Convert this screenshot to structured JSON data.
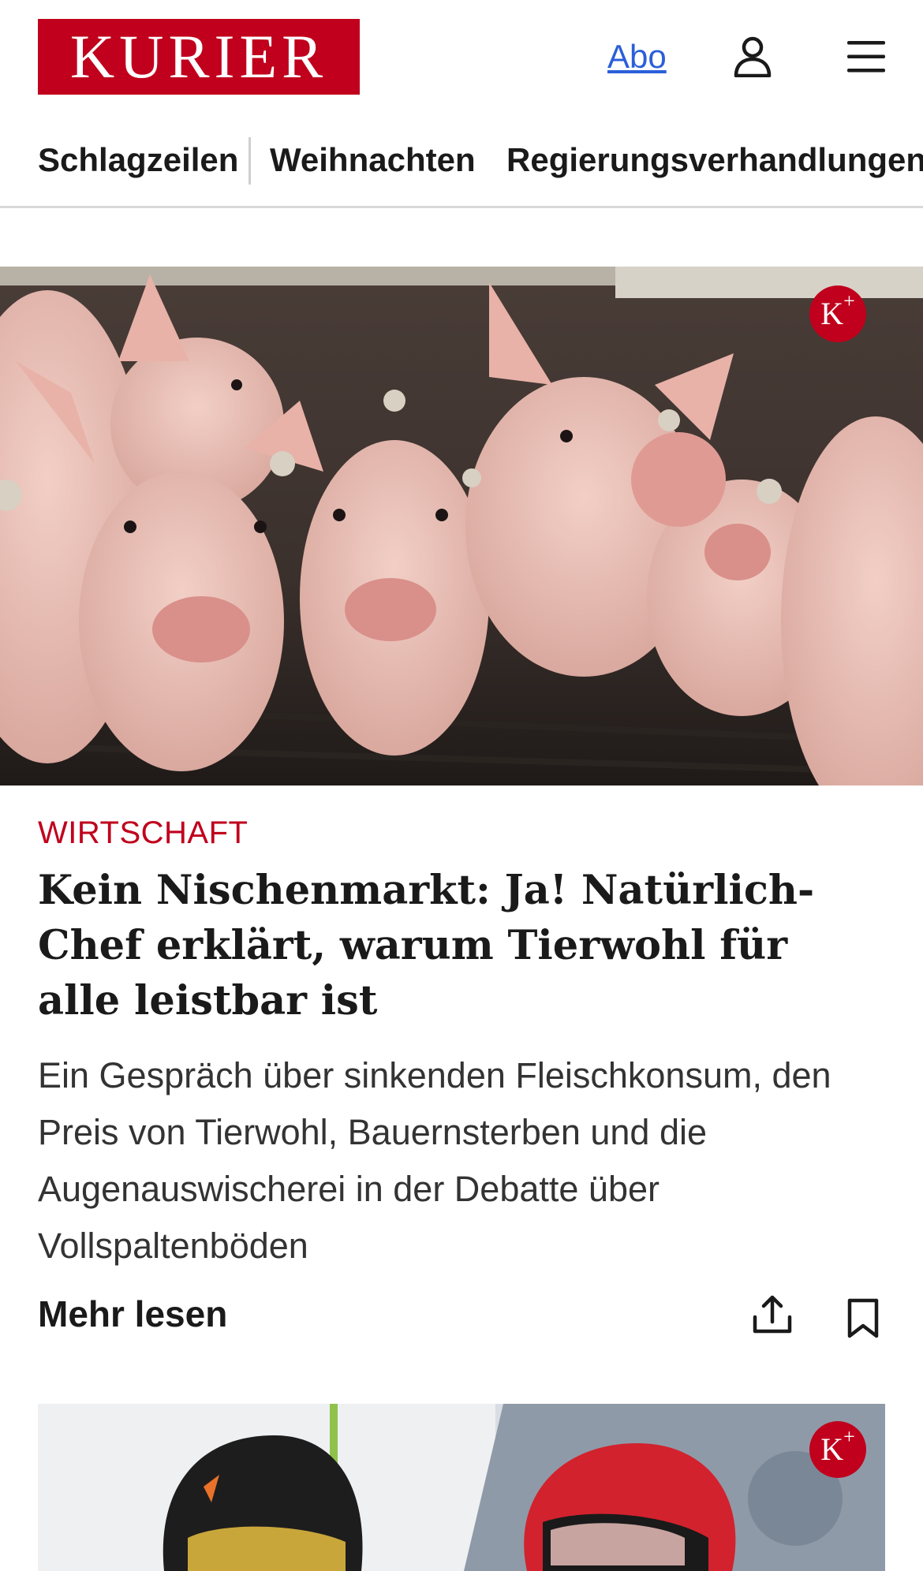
{
  "header": {
    "logo": "KURIER",
    "abo_label": "Abo"
  },
  "nav": {
    "items": [
      "Schlagzeilen",
      "Weihnachten",
      "Regierungsverhandlungen"
    ]
  },
  "hero": {
    "badge": "K",
    "badge_sup": "+",
    "category": "WIRTSCHAFT",
    "headline": "Kein Nischenmarkt: Ja! Natürlich-Chef erklärt, warum Tierwohl für alle leistbar ist",
    "teaser": "Ein Gespräch über sinkenden Fleischkonsum, den Preis von Tierwohl, Bauernsterben und die Augenauswischerei in der Debatte über Vollspaltenböden",
    "more_label": "Mehr lesen"
  },
  "second": {
    "badge": "K",
    "badge_sup": "+"
  },
  "colors": {
    "brand_red": "#c0001c",
    "link_blue": "#2b5fd9"
  },
  "icons": {
    "account": "user-icon",
    "menu": "hamburger-icon",
    "share": "share-icon",
    "bookmark": "bookmark-icon"
  }
}
